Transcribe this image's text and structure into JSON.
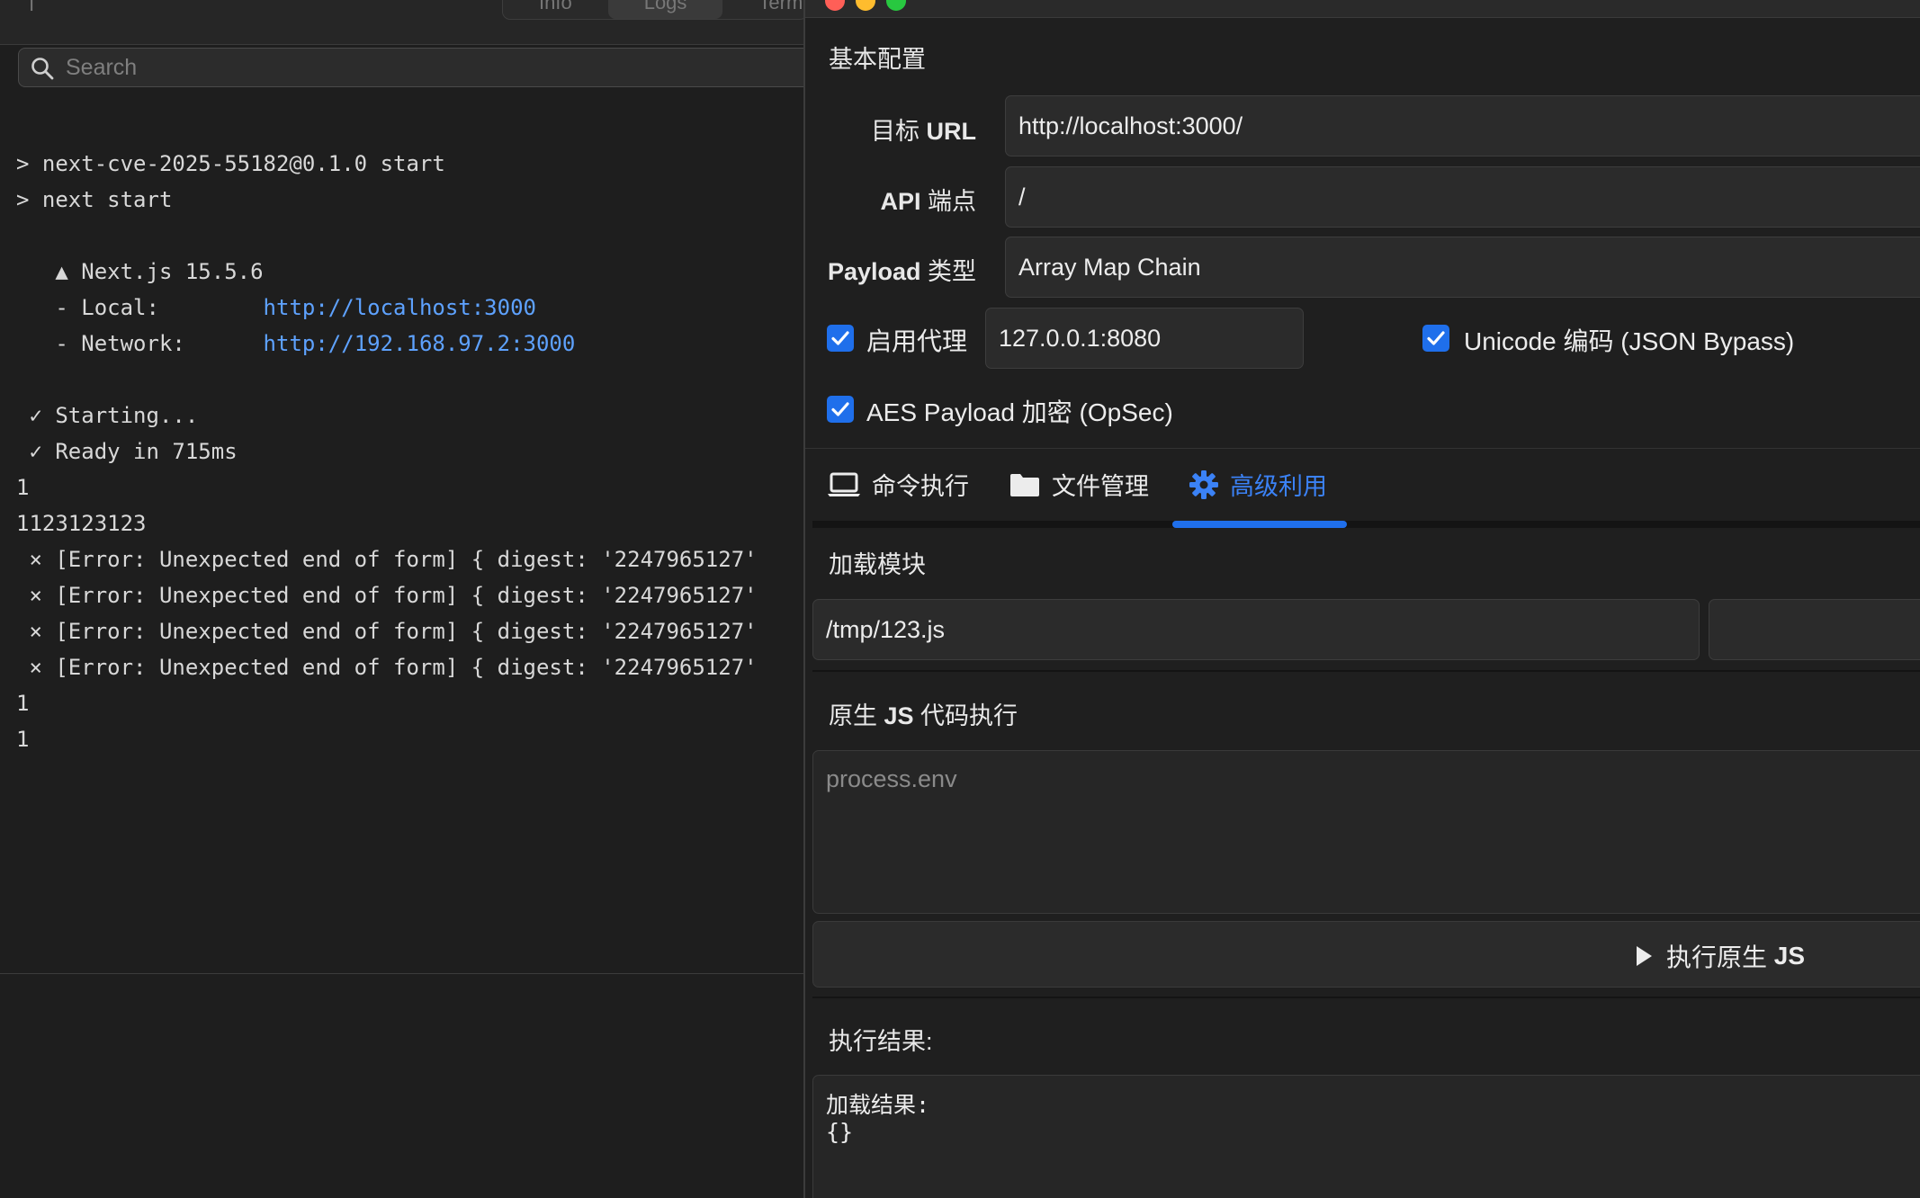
{
  "terminal": {
    "tabs": [
      "Info",
      "Logs",
      "Terminal"
    ],
    "search_placeholder": "Search",
    "lines": [
      {
        "text": "> next-cve-2025-55182@0.1.0 start"
      },
      {
        "text": "> next start"
      },
      {
        "text": ""
      },
      {
        "text": "   ▲ Next.js 15.5.6"
      },
      {
        "text": "   - Local:        ",
        "link": "http://localhost:3000"
      },
      {
        "text": "   - Network:      ",
        "link": "http://192.168.97.2:3000"
      },
      {
        "text": ""
      },
      {
        "text": " ✓ Starting..."
      },
      {
        "text": " ✓ Ready in 715ms"
      },
      {
        "text": "1"
      },
      {
        "text": "1123123123"
      },
      {
        "text": " ⨯ [Error: Unexpected end of form] { digest: '2247965127'"
      },
      {
        "text": " ⨯ [Error: Unexpected end of form] { digest: '2247965127'"
      },
      {
        "text": " ⨯ [Error: Unexpected end of form] { digest: '2247965127'"
      },
      {
        "text": " ⨯ [Error: Unexpected end of form] { digest: '2247965127'"
      },
      {
        "text": "1"
      },
      {
        "text": "1"
      }
    ]
  },
  "config": {
    "section_title": "基本配置",
    "target_url_label_prefix": "目标 ",
    "target_url_label_bold": "URL",
    "target_url_value": "http://localhost:3000/",
    "api_label_bold": "API",
    "api_label_suffix": " 端点",
    "api_value": "/",
    "payload_label_bold": "Payload",
    "payload_label_suffix": " 类型",
    "payload_value": "Array Map Chain",
    "proxy_label": "启用代理",
    "proxy_value": "127.0.0.1:8080",
    "unicode_label": "Unicode 编码 (JSON Bypass)",
    "aes_label": "AES Payload 加密 (OpSec)"
  },
  "tabs": [
    {
      "label": "命令执行",
      "icon": "laptop-icon"
    },
    {
      "label": "文件管理",
      "icon": "folder-icon"
    },
    {
      "label": "高级利用",
      "icon": "gear-icon",
      "active": true
    }
  ],
  "advanced": {
    "load_module_title": "加载模块",
    "module_path": "/tmp/123.js",
    "native_js_title_prefix": "原生 ",
    "native_js_title_bold": "JS",
    "native_js_title_suffix": " 代码执行",
    "js_placeholder": "process.env",
    "run_label_prefix": "执行原生 ",
    "run_label_bold": "JS",
    "result_title": "执行结果:",
    "result_text": "加载结果:\n{}"
  },
  "colors": {
    "accent": "#1f6feb",
    "link": "#5ea2ff",
    "background": "#1e1e1e"
  }
}
